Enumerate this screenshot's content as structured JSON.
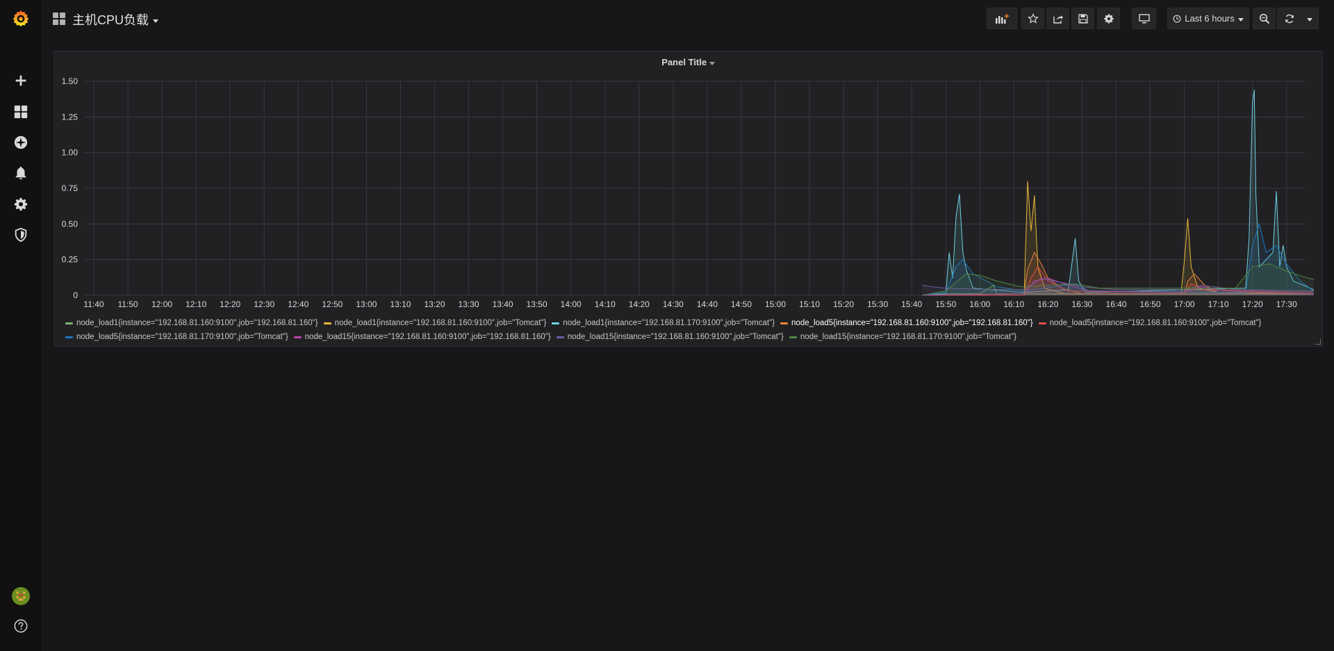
{
  "sidebar": {
    "items": [
      {
        "name": "grafana-logo",
        "icon": "grafana-logo"
      },
      {
        "name": "create",
        "icon": "plus-icon"
      },
      {
        "name": "dashboards",
        "icon": "apps-icon"
      },
      {
        "name": "explore",
        "icon": "compass-icon"
      },
      {
        "name": "alerting",
        "icon": "bell-icon"
      },
      {
        "name": "configuration",
        "icon": "gear-icon"
      },
      {
        "name": "server-admin",
        "icon": "shield-icon"
      },
      {
        "name": "profile",
        "icon": "avatar"
      },
      {
        "name": "help",
        "icon": "question-icon"
      }
    ]
  },
  "header": {
    "title": "主机CPU负载",
    "buttons": [
      "add-panel",
      "star",
      "share",
      "save",
      "settings",
      "tv-mode"
    ],
    "time_range": "Last 6 hours",
    "zoom_out": "zoom-out",
    "refresh": "refresh"
  },
  "panel": {
    "title": "Panel Title"
  },
  "chart_data": {
    "type": "line",
    "title": "Panel Title",
    "xlabel": "",
    "ylabel": "",
    "ylim": [
      0,
      1.5
    ],
    "y_ticks": [
      "0",
      "0.25",
      "0.50",
      "0.75",
      "1.00",
      "1.25",
      "1.50"
    ],
    "x_ticks": [
      "11:40",
      "11:50",
      "12:00",
      "12:10",
      "12:20",
      "12:30",
      "12:40",
      "12:50",
      "13:00",
      "13:10",
      "13:20",
      "13:30",
      "13:40",
      "13:50",
      "14:00",
      "14:10",
      "14:20",
      "14:30",
      "14:40",
      "14:50",
      "15:00",
      "15:10",
      "15:20",
      "15:30",
      "15:40",
      "15:50",
      "16:00",
      "16:10",
      "16:20",
      "16:30",
      "16:40",
      "16:50",
      "17:00",
      "17:10",
      "17:20",
      "17:30"
    ],
    "grid": true,
    "legend_position": "bottom",
    "series": [
      {
        "name": "node_load1{instance=\"192.168.81.160:9100\",job=\"192.168.81.160\"}",
        "color": "#7eb26d",
        "points": [
          [
            "15:43",
            0
          ],
          [
            "15:50",
            0.01
          ],
          [
            "16:00",
            0.01
          ],
          [
            "16:04",
            0.07
          ],
          [
            "16:05",
            0.01
          ],
          [
            "16:30",
            0.01
          ],
          [
            "17:00",
            0.01
          ],
          [
            "17:38",
            0.01
          ]
        ]
      },
      {
        "name": "node_load1{instance=\"192.168.81.160:9100\",job=\"Tomcat\"}",
        "color": "#eab839",
        "points": [
          [
            "15:43",
            0
          ],
          [
            "16:13",
            0
          ],
          [
            "16:14",
            0.8
          ],
          [
            "16:15",
            0.45
          ],
          [
            "16:16",
            0.7
          ],
          [
            "16:17",
            0.2
          ],
          [
            "16:19",
            0.05
          ],
          [
            "16:25",
            0.01
          ],
          [
            "16:59",
            0.01
          ],
          [
            "17:00",
            0.24
          ],
          [
            "17:01",
            0.54
          ],
          [
            "17:02",
            0.2
          ],
          [
            "17:04",
            0.05
          ],
          [
            "17:10",
            0.02
          ],
          [
            "17:38",
            0.01
          ]
        ]
      },
      {
        "name": "node_load1{instance=\"192.168.81.170:9100\",job=\"Tomcat\"}",
        "color": "#6ed0e0",
        "points": [
          [
            "15:43",
            0
          ],
          [
            "15:50",
            0.01
          ],
          [
            "15:51",
            0.3
          ],
          [
            "15:52",
            0.12
          ],
          [
            "15:53",
            0.55
          ],
          [
            "15:54",
            0.71
          ],
          [
            "15:55",
            0.3
          ],
          [
            "15:56",
            0.18
          ],
          [
            "15:58",
            0.05
          ],
          [
            "16:13",
            0.02
          ],
          [
            "16:26",
            0.04
          ],
          [
            "16:28",
            0.4
          ],
          [
            "16:29",
            0.1
          ],
          [
            "16:31",
            0.02
          ],
          [
            "17:18",
            0.05
          ],
          [
            "17:19",
            0.4
          ],
          [
            "17:20",
            1.35
          ],
          [
            "17:20.5",
            1.44
          ],
          [
            "17:21",
            0.7
          ],
          [
            "17:22",
            0.2
          ],
          [
            "17:26",
            0.3
          ],
          [
            "17:27",
            0.73
          ],
          [
            "17:28",
            0.2
          ],
          [
            "17:29",
            0.35
          ],
          [
            "17:30",
            0.2
          ],
          [
            "17:32",
            0.1
          ],
          [
            "17:38",
            0.04
          ]
        ]
      },
      {
        "name": "node_load5{instance=\"192.168.81.160:9100\",job=\"192.168.81.160\"}",
        "color": "#ef843c",
        "points": [
          [
            "15:43",
            0
          ],
          [
            "16:13",
            0.01
          ],
          [
            "16:14",
            0.18
          ],
          [
            "16:16",
            0.3
          ],
          [
            "16:18",
            0.22
          ],
          [
            "16:20",
            0.12
          ],
          [
            "16:24",
            0.05
          ],
          [
            "16:30",
            0.01
          ],
          [
            "17:00",
            0.01
          ],
          [
            "17:01",
            0.1
          ],
          [
            "17:03",
            0.15
          ],
          [
            "17:06",
            0.07
          ],
          [
            "17:10",
            0.02
          ],
          [
            "17:38",
            0.01
          ]
        ]
      },
      {
        "name": "node_load5{instance=\"192.168.81.160:9100\",job=\"Tomcat\"}",
        "color": "#e24d42",
        "points": [
          [
            "15:43",
            0
          ],
          [
            "16:13",
            0
          ],
          [
            "16:15",
            0.12
          ],
          [
            "16:17",
            0.2
          ],
          [
            "16:20",
            0.1
          ],
          [
            "16:26",
            0.03
          ],
          [
            "17:00",
            0.02
          ],
          [
            "17:02",
            0.08
          ],
          [
            "17:06",
            0.04
          ],
          [
            "17:37",
            0.02
          ],
          [
            "17:38",
            0.04
          ]
        ]
      },
      {
        "name": "node_load5{instance=\"192.168.81.170:9100\",job=\"Tomcat\"}",
        "color": "#1f78c1",
        "points": [
          [
            "15:43",
            0
          ],
          [
            "15:50",
            0.02
          ],
          [
            "15:53",
            0.2
          ],
          [
            "15:55",
            0.25
          ],
          [
            "15:58",
            0.15
          ],
          [
            "16:05",
            0.06
          ],
          [
            "16:13",
            0.03
          ],
          [
            "16:28",
            0.08
          ],
          [
            "16:32",
            0.03
          ],
          [
            "17:18",
            0.02
          ],
          [
            "17:20",
            0.35
          ],
          [
            "17:22",
            0.5
          ],
          [
            "17:24",
            0.3
          ],
          [
            "17:27",
            0.35
          ],
          [
            "17:30",
            0.22
          ],
          [
            "17:34",
            0.1
          ],
          [
            "17:38",
            0.03
          ]
        ]
      },
      {
        "name": "node_load15{instance=\"192.168.81.160:9100\",job=\"192.168.81.160\"}",
        "color": "#ba43a9",
        "points": [
          [
            "15:43",
            0
          ],
          [
            "16:13",
            0.01
          ],
          [
            "16:16",
            0.1
          ],
          [
            "16:20",
            0.12
          ],
          [
            "16:25",
            0.08
          ],
          [
            "16:32",
            0.03
          ],
          [
            "17:00",
            0.02
          ],
          [
            "17:05",
            0.06
          ],
          [
            "17:12",
            0.03
          ],
          [
            "17:38",
            0.01
          ]
        ]
      },
      {
        "name": "node_load15{instance=\"192.168.81.160:9100\",job=\"Tomcat\"}",
        "color": "#705da0",
        "points": [
          [
            "15:43",
            0.07
          ],
          [
            "15:46",
            0.06
          ],
          [
            "15:50",
            0.05
          ],
          [
            "16:05",
            0.04
          ],
          [
            "16:13",
            0.04
          ],
          [
            "16:18",
            0.12
          ],
          [
            "16:22",
            0.1
          ],
          [
            "16:30",
            0.06
          ],
          [
            "16:40",
            0.04
          ],
          [
            "17:00",
            0.04
          ],
          [
            "17:05",
            0.07
          ],
          [
            "17:15",
            0.04
          ],
          [
            "17:38",
            0.03
          ]
        ]
      },
      {
        "name": "node_load15{instance=\"192.168.81.170:9100\",job=\"Tomcat\"}",
        "color": "#508642",
        "points": [
          [
            "15:43",
            0
          ],
          [
            "15:50",
            0.03
          ],
          [
            "15:56",
            0.15
          ],
          [
            "16:00",
            0.14
          ],
          [
            "16:05",
            0.1
          ],
          [
            "16:12",
            0.06
          ],
          [
            "16:28",
            0.08
          ],
          [
            "16:35",
            0.05
          ],
          [
            "17:15",
            0.05
          ],
          [
            "17:20",
            0.2
          ],
          [
            "17:25",
            0.22
          ],
          [
            "17:30",
            0.17
          ],
          [
            "17:35",
            0.13
          ],
          [
            "17:38",
            0.11
          ]
        ]
      }
    ]
  }
}
